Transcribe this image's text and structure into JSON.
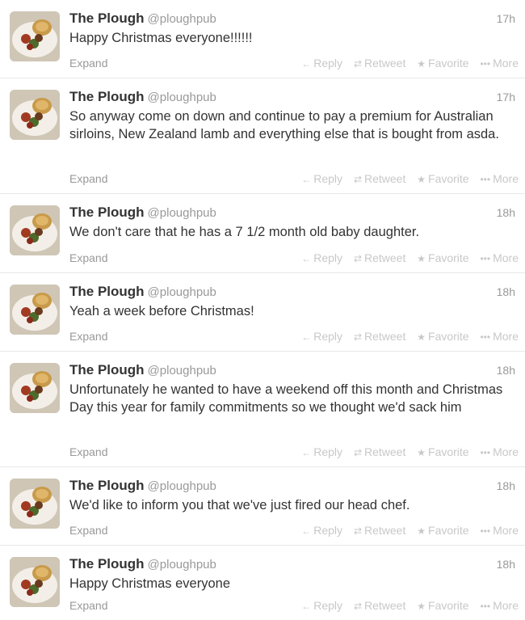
{
  "tweets": [
    {
      "name": "The Plough",
      "handle": "@ploughpub",
      "time": "17h",
      "text": "Happy Christmas everyone!!!!!!",
      "expand": "Expand",
      "actions": {
        "reply": "Reply",
        "retweet": "Retweet",
        "favorite": "Favorite",
        "more": "More"
      }
    },
    {
      "name": "The Plough",
      "handle": "@ploughpub",
      "time": "17h",
      "text": "So anyway come on down and continue to pay a premium for Australian sirloins, New Zealand lamb and everything else that is bought from asda.",
      "expand": "Expand",
      "actions": {
        "reply": "Reply",
        "retweet": "Retweet",
        "favorite": "Favorite",
        "more": "More"
      }
    },
    {
      "name": "The Plough",
      "handle": "@ploughpub",
      "time": "18h",
      "text": "We don't care that he has a 7 1/2 month old baby daughter.",
      "expand": "Expand",
      "actions": {
        "reply": "Reply",
        "retweet": "Retweet",
        "favorite": "Favorite",
        "more": "More"
      }
    },
    {
      "name": "The Plough",
      "handle": "@ploughpub",
      "time": "18h",
      "text": "Yeah a week before Christmas!",
      "expand": "Expand",
      "actions": {
        "reply": "Reply",
        "retweet": "Retweet",
        "favorite": "Favorite",
        "more": "More"
      }
    },
    {
      "name": "The Plough",
      "handle": "@ploughpub",
      "time": "18h",
      "text": "Unfortunately he wanted to have a weekend off this month and Christmas Day this year for family commitments so we thought we'd sack him",
      "expand": "Expand",
      "actions": {
        "reply": "Reply",
        "retweet": "Retweet",
        "favorite": "Favorite",
        "more": "More"
      }
    },
    {
      "name": "The Plough",
      "handle": "@ploughpub",
      "time": "18h",
      "text": "We'd like to inform you that we've just fired our head chef.",
      "expand": "Expand",
      "actions": {
        "reply": "Reply",
        "retweet": "Retweet",
        "favorite": "Favorite",
        "more": "More"
      }
    },
    {
      "name": "The Plough",
      "handle": "@ploughpub",
      "time": "18h",
      "text": "Happy Christmas everyone",
      "expand": "Expand",
      "actions": {
        "reply": "Reply",
        "retweet": "Retweet",
        "favorite": "Favorite",
        "more": "More"
      }
    }
  ],
  "icons": {
    "reply": "reply-arrow-icon",
    "retweet": "retweet-icon",
    "favorite": "star-icon",
    "more": "ellipsis-icon"
  },
  "colors": {
    "name": "#333333",
    "meta": "#999999",
    "action": "#c8c8c8",
    "divider": "#e8e8e8"
  }
}
